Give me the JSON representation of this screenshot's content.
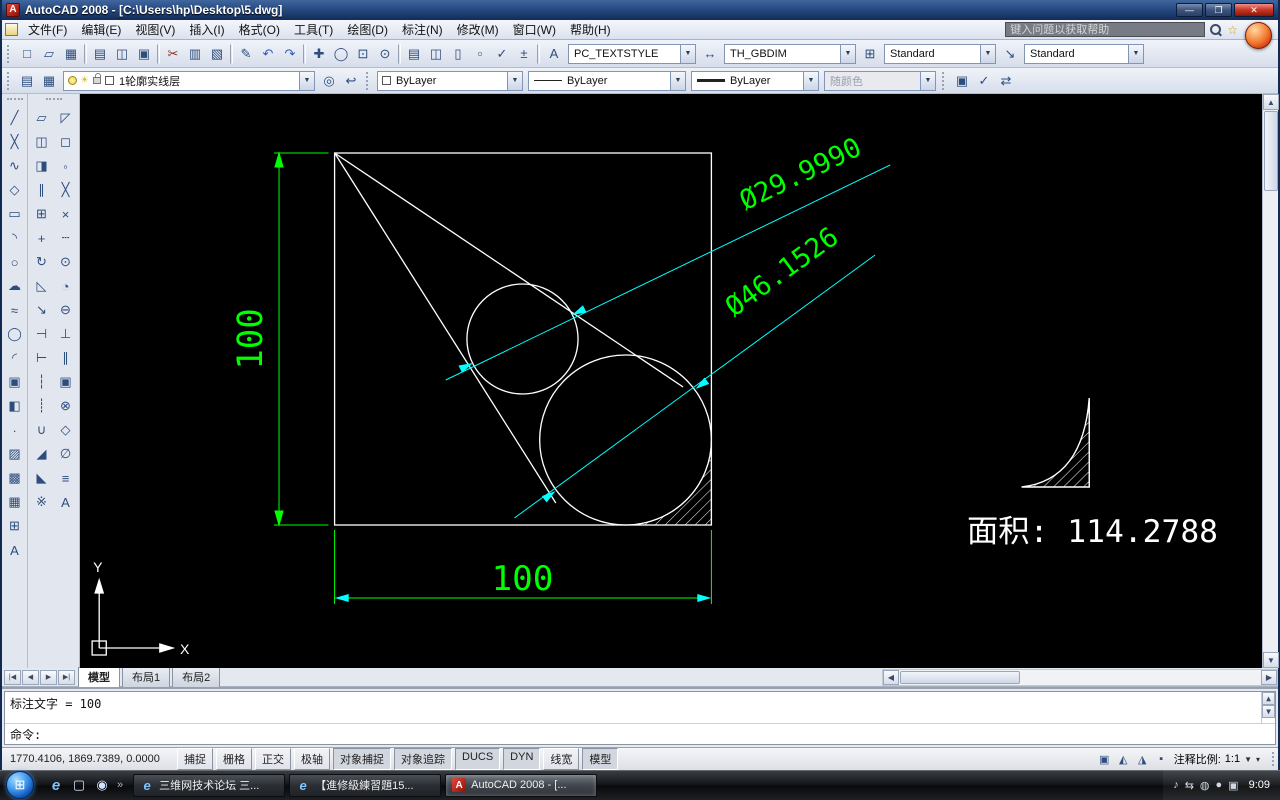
{
  "colors": {
    "dim_green": "#00ff00",
    "leader_cyan": "#00ffff",
    "geometry": "#ffffff",
    "canvas_bg": "#000000",
    "titlebar": "#1c3a6e",
    "taskbar": "#17191d"
  },
  "window": {
    "title": "AutoCAD 2008 - [C:\\Users\\hp\\Desktop\\5.dwg]",
    "minimize": "—",
    "maximize": "❐",
    "close": "✕"
  },
  "menubar": {
    "items": [
      {
        "label": "文件(F)"
      },
      {
        "label": "编辑(E)"
      },
      {
        "label": "视图(V)"
      },
      {
        "label": "插入(I)"
      },
      {
        "label": "格式(O)"
      },
      {
        "label": "工具(T)"
      },
      {
        "label": "绘图(D)"
      },
      {
        "label": "标注(N)"
      },
      {
        "label": "修改(M)"
      },
      {
        "label": "窗口(W)"
      },
      {
        "label": "帮助(H)"
      }
    ],
    "search_placeholder": "键入问题以获取帮助"
  },
  "toolbar_standard": {
    "icons": [
      {
        "name": "qnew-icon",
        "glyph": "□",
        "ia": true
      },
      {
        "name": "open-file-icon",
        "glyph": "▱",
        "ia": true
      },
      {
        "name": "save-icon",
        "glyph": "▦",
        "ia": true
      },
      {
        "name": "toolbar-divider",
        "glyph": "",
        "cls": "divider",
        "ia": false
      },
      {
        "name": "plot-icon",
        "glyph": "▤",
        "ia": true
      },
      {
        "name": "plot-preview-icon",
        "glyph": "◫",
        "ia": true
      },
      {
        "name": "publish-icon",
        "glyph": "▣",
        "ia": true
      },
      {
        "name": "toolbar-divider",
        "glyph": "",
        "cls": "divider",
        "ia": false
      },
      {
        "name": "cut-icon",
        "glyph": "✂",
        "c": "#8a2b2b",
        "ia": true
      },
      {
        "name": "copy-clip-icon",
        "glyph": "▥",
        "ia": true
      },
      {
        "name": "paste-icon",
        "glyph": "▧",
        "ia": true
      },
      {
        "name": "toolbar-divider",
        "glyph": "",
        "cls": "divider",
        "ia": false
      },
      {
        "name": "match-properties-icon",
        "glyph": "✎",
        "ia": true
      },
      {
        "name": "undo-icon",
        "glyph": "↶",
        "c": "#2f5bbf",
        "ia": true
      },
      {
        "name": "redo-icon",
        "glyph": "↷",
        "c": "#2f5bbf",
        "ia": true
      },
      {
        "name": "toolbar-divider",
        "glyph": "",
        "cls": "divider",
        "ia": false
      },
      {
        "name": "pan-icon",
        "glyph": "✚",
        "ia": true
      },
      {
        "name": "zoom-realtime-icon",
        "glyph": "◯",
        "ia": true
      },
      {
        "name": "zoom-window-icon",
        "glyph": "⊡",
        "ia": true
      },
      {
        "name": "zoom-previous-icon",
        "glyph": "⊙",
        "ia": true
      },
      {
        "name": "toolbar-divider",
        "glyph": "",
        "cls": "divider",
        "ia": false
      },
      {
        "name": "properties-palette-icon",
        "glyph": "▤",
        "ia": true
      },
      {
        "name": "designcenter-icon",
        "glyph": "◫",
        "ia": true
      },
      {
        "name": "tool-palettes-icon",
        "glyph": "▯",
        "ia": true
      },
      {
        "name": "sheetset-manager-icon",
        "glyph": "▫",
        "ia": true
      },
      {
        "name": "markup-manager-icon",
        "glyph": "✓",
        "ia": true
      },
      {
        "name": "quickcalc-icon",
        "glyph": "±",
        "ia": true
      },
      {
        "name": "toolbar-divider",
        "glyph": "",
        "cls": "divider",
        "ia": false
      }
    ],
    "text_style_icon": "A",
    "text_style": "PC_TEXTSTYLE",
    "dim_style_icon": "↔",
    "dim_style": "TH_GBDIM",
    "table_style_icon": "⊞",
    "table_style": "Standard",
    "multileader_style_icon": "↘",
    "multileader_style": "Standard"
  },
  "toolbar_layers": {
    "left_icons": [
      {
        "name": "layer-properties-manager-icon",
        "glyph": "▤",
        "ia": true
      },
      {
        "name": "layer-states-icon",
        "glyph": "▦",
        "ia": true
      }
    ],
    "layer_value": "1轮廓实线层",
    "after_icons": [
      {
        "name": "make-object-layer-current-icon",
        "glyph": "◎",
        "ia": true
      },
      {
        "name": "layer-previous-icon",
        "glyph": "↩",
        "ia": true
      }
    ],
    "color_value": "ByLayer",
    "linetype_value": "ByLayer",
    "lineweight_value": "ByLayer",
    "plotstyle_value": "随颜色",
    "right_icons": [
      {
        "name": "standards-icon",
        "glyph": "▣",
        "ia": true
      },
      {
        "name": "check-standards-icon",
        "glyph": "✓",
        "ia": true
      },
      {
        "name": "layer-translator-icon",
        "glyph": "⇄",
        "ia": true
      }
    ]
  },
  "draw_toolbar": [
    {
      "name": "line-icon",
      "glyph": "╱",
      "ia": true
    },
    {
      "name": "construction-line-icon",
      "glyph": "╳",
      "ia": true
    },
    {
      "name": "polyline-icon",
      "glyph": "∿",
      "ia": true
    },
    {
      "name": "polygon-icon",
      "glyph": "◇",
      "ia": true
    },
    {
      "name": "rectangle-icon",
      "glyph": "▭",
      "ia": true
    },
    {
      "name": "arc-icon",
      "glyph": "◝",
      "ia": true
    },
    {
      "name": "circle-icon",
      "glyph": "○",
      "ia": true
    },
    {
      "name": "revision-cloud-icon",
      "glyph": "☁",
      "ia": true
    },
    {
      "name": "spline-icon",
      "glyph": "≈",
      "ia": true
    },
    {
      "name": "ellipse-icon",
      "glyph": "◯",
      "ia": true
    },
    {
      "name": "ellipse-arc-icon",
      "glyph": "◜",
      "ia": true
    },
    {
      "name": "insert-block-icon",
      "glyph": "▣",
      "ia": true
    },
    {
      "name": "make-block-icon",
      "glyph": "◧",
      "ia": true
    },
    {
      "name": "point-icon",
      "glyph": "∙",
      "ia": true
    },
    {
      "name": "hatch-icon",
      "glyph": "▨",
      "ia": true
    },
    {
      "name": "gradient-icon",
      "glyph": "▩",
      "ia": true
    },
    {
      "name": "region-icon",
      "glyph": "▦",
      "ia": true
    },
    {
      "name": "table-icon",
      "glyph": "⊞",
      "ia": true
    },
    {
      "name": "multiline-text-icon",
      "glyph": "A",
      "ia": true
    }
  ],
  "modify_osnap_toolbar": [
    {
      "name": "erase-icon",
      "glyph": "▱",
      "ia": true
    },
    {
      "name": "snap-from-icon",
      "glyph": "◸",
      "ia": true
    },
    {
      "name": "copy-icon",
      "glyph": "◫",
      "ia": true
    },
    {
      "name": "snap-endpoint-icon",
      "glyph": "◻",
      "ia": true
    },
    {
      "name": "mirror-icon",
      "glyph": "◨",
      "ia": true
    },
    {
      "name": "snap-midpoint-icon",
      "glyph": "◦",
      "ia": true
    },
    {
      "name": "offset-icon",
      "glyph": "∥",
      "ia": true
    },
    {
      "name": "snap-intersection-icon",
      "glyph": "╳",
      "ia": true
    },
    {
      "name": "array-icon",
      "glyph": "⊞",
      "ia": true
    },
    {
      "name": "snap-apparent-icon",
      "glyph": "×",
      "ia": true
    },
    {
      "name": "move-icon",
      "glyph": "+",
      "ia": true
    },
    {
      "name": "snap-extension-icon",
      "glyph": "┄",
      "ia": true
    },
    {
      "name": "rotate-icon",
      "glyph": "↻",
      "ia": true
    },
    {
      "name": "snap-center-icon",
      "glyph": "⊙",
      "ia": true
    },
    {
      "name": "scale-icon",
      "glyph": "◺",
      "ia": true
    },
    {
      "name": "snap-quadrant-icon",
      "glyph": "◔",
      "ia": true
    },
    {
      "name": "stretch-icon",
      "glyph": "↘",
      "ia": true
    },
    {
      "name": "snap-tangent-icon",
      "glyph": "⊖",
      "ia": true
    },
    {
      "name": "trim-icon",
      "glyph": "⊣",
      "ia": true
    },
    {
      "name": "snap-perpendicular-icon",
      "glyph": "⊥",
      "ia": true
    },
    {
      "name": "extend-icon",
      "glyph": "⊢",
      "ia": true
    },
    {
      "name": "snap-parallel-icon",
      "glyph": "∥",
      "ia": true
    },
    {
      "name": "break-at-point-icon",
      "glyph": "┆",
      "ia": true
    },
    {
      "name": "snap-insert-icon",
      "glyph": "▣",
      "ia": true
    },
    {
      "name": "break-icon",
      "glyph": "┊",
      "ia": true
    },
    {
      "name": "snap-node-icon",
      "glyph": "⊗",
      "ia": true
    },
    {
      "name": "join-icon",
      "glyph": "∪",
      "ia": true
    },
    {
      "name": "snap-nearest-icon",
      "glyph": "◇",
      "ia": true
    },
    {
      "name": "chamfer-icon",
      "glyph": "◢",
      "ia": true
    },
    {
      "name": "snap-none-icon",
      "glyph": "∅",
      "ia": true
    },
    {
      "name": "fillet-icon",
      "glyph": "◣",
      "ia": true
    },
    {
      "name": "osnap-settings-icon",
      "glyph": "≡",
      "ia": true
    },
    {
      "name": "explode-icon",
      "glyph": "※",
      "ia": true
    },
    {
      "name": "mtext-icon",
      "glyph": "A",
      "ia": true
    }
  ],
  "canvas": {
    "dim_vertical": "100",
    "dim_horizontal": "100",
    "dia_small": "Ø29.9990",
    "dia_large": "Ø46.1526",
    "area_label": "面积: 114.2788",
    "ucs_x": "X",
    "ucs_y": "Y"
  },
  "tabs": {
    "nav": [
      {
        "name": "tab-nav-first",
        "glyph": "|◀",
        "ia": true
      },
      {
        "name": "tab-nav-prev",
        "glyph": "◀",
        "ia": true
      },
      {
        "name": "tab-nav-next",
        "glyph": "▶",
        "ia": true
      },
      {
        "name": "tab-nav-last",
        "glyph": "▶|",
        "ia": true
      }
    ],
    "items": [
      {
        "name": "tab-model",
        "label": "模型",
        "active": true,
        "ia": true
      },
      {
        "name": "tab-layout1",
        "label": "布局1",
        "ia": true
      },
      {
        "name": "tab-layout2",
        "label": "布局2",
        "ia": true
      }
    ]
  },
  "command": {
    "history": "标注文字 = 100",
    "prompt": "命令:"
  },
  "statusbar": {
    "coords": "1770.4106, 1869.7389, 0.0000",
    "toggles": [
      {
        "name": "toggle-snap",
        "label": "捕捉",
        "ia": true
      },
      {
        "name": "toggle-grid",
        "label": "栅格",
        "ia": true
      },
      {
        "name": "toggle-ortho",
        "label": "正交",
        "ia": true
      },
      {
        "name": "toggle-polar",
        "label": "极轴",
        "ia": true
      },
      {
        "name": "toggle-osnap",
        "label": "对象捕捉",
        "pressed": true,
        "ia": true
      },
      {
        "name": "toggle-otrack",
        "label": "对象追踪",
        "pressed": true,
        "ia": true
      },
      {
        "name": "toggle-ducs",
        "label": "DUCS",
        "pressed": true,
        "ia": true
      },
      {
        "name": "toggle-dyn",
        "label": "DYN",
        "pressed": true,
        "ia": true
      },
      {
        "name": "toggle-lineweight",
        "label": "线宽",
        "ia": true
      },
      {
        "name": "toggle-model",
        "label": "模型",
        "pressed": true,
        "ia": true
      }
    ],
    "annotation_scale_label": "注释比例:",
    "annotation_scale_value": "1:1",
    "right_icons": [
      {
        "name": "model-space-icon",
        "glyph": "▣",
        "ia": true
      },
      {
        "name": "annotation-visibility-icon",
        "glyph": "◭",
        "ia": true
      },
      {
        "name": "annotation-autoscale-icon",
        "glyph": "◮",
        "ia": true
      },
      {
        "name": "cleanscreen-icon",
        "glyph": "▪",
        "ia": true
      }
    ]
  },
  "taskbar": {
    "start_glyph": "⊞",
    "quick_launch": [
      {
        "name": "quick-launch-ie-icon",
        "glyph": "e",
        "cls": "ie",
        "ia": true
      },
      {
        "name": "quick-launch-desktop-icon",
        "glyph": "▢",
        "ia": true
      },
      {
        "name": "quick-launch-media-icon",
        "glyph": "◉",
        "ia": true
      }
    ],
    "quick_launch_more": "»",
    "buttons": [
      {
        "name": "taskbar-button-forum",
        "icon": "e",
        "icon_cls": "ie",
        "label": "三维网技术论坛 三...",
        "ia": true
      },
      {
        "name": "taskbar-button-exercise",
        "icon": "e",
        "icon_cls": "ie",
        "label": "【進修級練習題15...",
        "ia": true
      },
      {
        "name": "taskbar-button-autocad",
        "icon": "A",
        "icon_cls": "acad",
        "label": "AutoCAD 2008 - [...",
        "active": true,
        "ia": true
      }
    ],
    "tray_icons": [
      {
        "name": "tray-volume-icon",
        "glyph": "♪",
        "ia": true
      },
      {
        "name": "tray-network-icon",
        "glyph": "⇆",
        "ia": true
      },
      {
        "name": "tray-update-icon",
        "glyph": "◍",
        "ia": true
      },
      {
        "name": "tray-antivirus-icon",
        "glyph": "●",
        "ia": true
      },
      {
        "name": "tray-language-icon",
        "glyph": "▣",
        "ia": true
      }
    ],
    "clock": "9:09"
  }
}
